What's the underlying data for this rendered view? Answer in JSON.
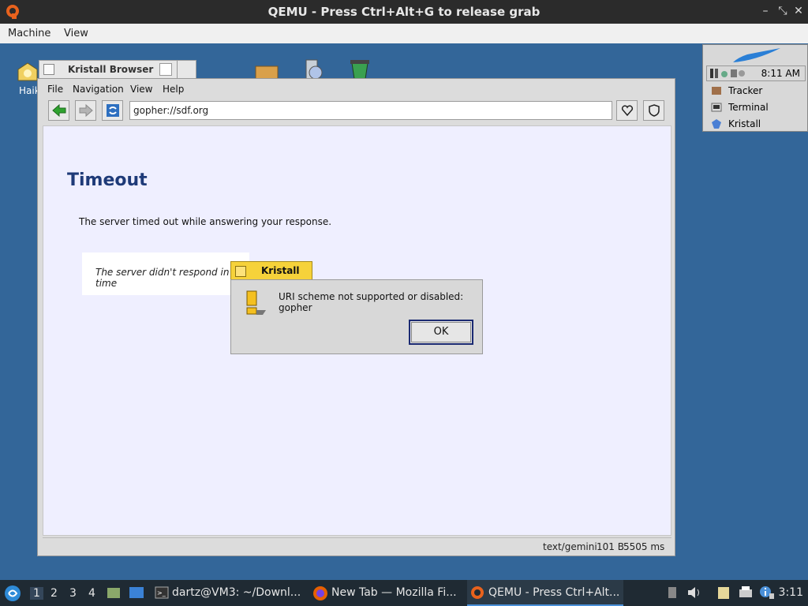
{
  "qemu": {
    "title": "QEMU - Press Ctrl+Alt+G to release grab",
    "menu": [
      "Machine",
      "View"
    ],
    "controls": [
      "–",
      "⤡",
      "✕"
    ]
  },
  "desktop": {
    "icon_label": "Haik"
  },
  "deskbar": {
    "clock": "8:11 AM",
    "items": [
      "Tracker",
      "Terminal",
      "Kristall"
    ]
  },
  "browser": {
    "title": "Kristall Browser",
    "menu": [
      "File",
      "Navigation",
      "View",
      "Help"
    ],
    "url": "gopher://sdf.org",
    "page": {
      "heading": "Timeout",
      "paragraph": "The server timed out while answering your response.",
      "quote": "The server didn't respond in time"
    },
    "status": {
      "mime": "text/gemini",
      "size": "101 B",
      "time": "5505 ms"
    }
  },
  "alert": {
    "title": "Kristall",
    "message": "URI scheme not supported or disabled: gopher",
    "ok_label": "OK"
  },
  "taskbar": {
    "workspaces": [
      "1",
      "2",
      "3",
      "4"
    ],
    "tasks": [
      {
        "label": "dartz@VM3: ~/Downl..."
      },
      {
        "label": "New Tab — Mozilla Fi..."
      },
      {
        "label": "QEMU - Press Ctrl+Alt..."
      }
    ],
    "clock": "3:11"
  },
  "colors": {
    "desktop": "#336699",
    "heading": "#1e3a78",
    "alert_tab": "#f6d23a",
    "ok_border": "#1b2a72"
  }
}
